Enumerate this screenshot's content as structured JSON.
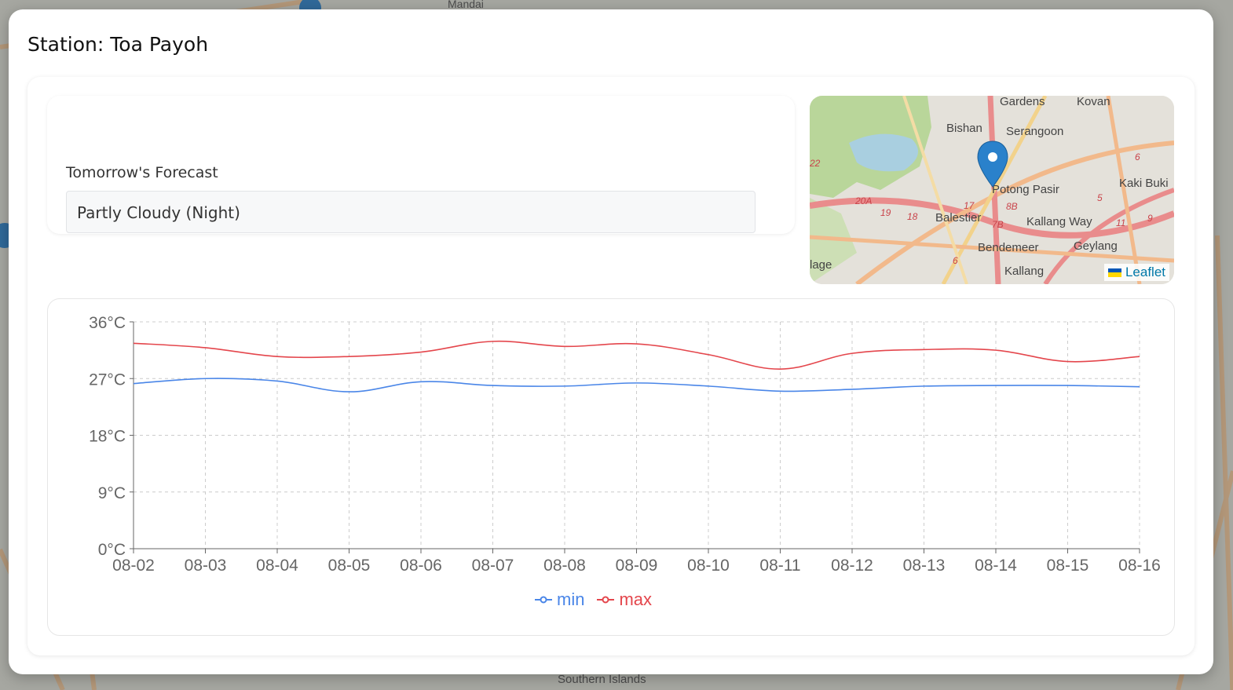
{
  "station": {
    "title": "Station: Toa Payoh"
  },
  "forecast": {
    "label": "Tomorrow's Forecast",
    "value": "Partly Cloudy (Night)"
  },
  "map": {
    "attribution": "Leaflet",
    "place_labels": [
      "Gardens",
      "Kovan",
      "Bishan",
      "Serangoon",
      "Potong Pasir",
      "Kaki Buki",
      "Balestier",
      "Kallang Way",
      "Bendemeer",
      "Geylang",
      "Kallang",
      "lage"
    ],
    "road_labels": [
      "20A",
      "19",
      "18",
      "17",
      "8B",
      "7B",
      "6",
      "5",
      "6",
      "11",
      "9",
      "22"
    ],
    "background_labels": [
      "Mandai",
      "Southern Islands"
    ]
  },
  "colors": {
    "min": "#4a86e8",
    "max": "#e4464c"
  },
  "chart_data": {
    "type": "line",
    "categories": [
      "08-02",
      "08-03",
      "08-04",
      "08-05",
      "08-06",
      "08-07",
      "08-08",
      "08-09",
      "08-10",
      "08-11",
      "08-12",
      "08-13",
      "08-14",
      "08-15",
      "08-16"
    ],
    "series": [
      {
        "name": "min",
        "values": [
          26.2,
          27.0,
          26.6,
          24.9,
          26.5,
          25.9,
          25.8,
          26.3,
          25.8,
          25.0,
          25.3,
          25.8,
          25.9,
          25.9,
          25.7
        ]
      },
      {
        "name": "max",
        "values": [
          32.6,
          31.9,
          30.5,
          30.5,
          31.2,
          32.9,
          32.1,
          32.5,
          30.8,
          28.5,
          31.0,
          31.6,
          31.5,
          29.7,
          30.5
        ]
      }
    ],
    "yticks": [
      "0°C",
      "9°C",
      "18°C",
      "27°C",
      "36°C"
    ],
    "ylim": [
      0,
      36
    ],
    "grid": true,
    "legend": "bottom-center"
  }
}
